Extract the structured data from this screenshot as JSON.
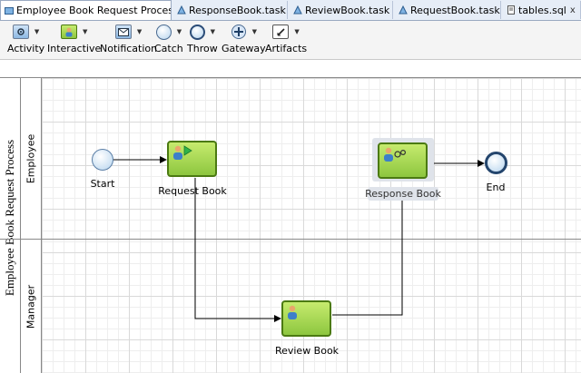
{
  "tabs": [
    {
      "label": "Employee Book Request Process",
      "close": "×",
      "active": true
    },
    {
      "label": "ResponseBook.task",
      "close": "x",
      "active": false
    },
    {
      "label": "ReviewBook.task",
      "close": "x",
      "active": false
    },
    {
      "label": "RequestBook.task",
      "close": "x",
      "active": false
    },
    {
      "label": "tables.sql",
      "close": "x",
      "active": false
    }
  ],
  "toolbar": [
    {
      "label": "Activity",
      "icon": "activity-icon"
    },
    {
      "label": "Interactive",
      "icon": "interactive-icon"
    },
    {
      "label": "Notification",
      "icon": "notification-icon"
    },
    {
      "label": "Catch",
      "icon": "catch-icon"
    },
    {
      "label": "Throw",
      "icon": "throw-icon"
    },
    {
      "label": "Gateway",
      "icon": "gateway-icon"
    },
    {
      "label": "Artifacts",
      "icon": "artifacts-icon"
    }
  ],
  "pool": {
    "title": "Employee Book Request Process"
  },
  "lanes": [
    {
      "label": "Employee"
    },
    {
      "label": "Manager"
    }
  ],
  "nodes": {
    "start": {
      "label": "Start"
    },
    "request_book": {
      "label": "Request Book"
    },
    "response_book": {
      "label": "Response Book"
    },
    "review_book": {
      "label": "Review Book"
    },
    "end": {
      "label": "End"
    }
  },
  "colors": {
    "task_fill": "#8dc63f",
    "task_border": "#4b7a12",
    "event_fill": "#b6d4ee",
    "tab_bar": "#e6edf7"
  }
}
